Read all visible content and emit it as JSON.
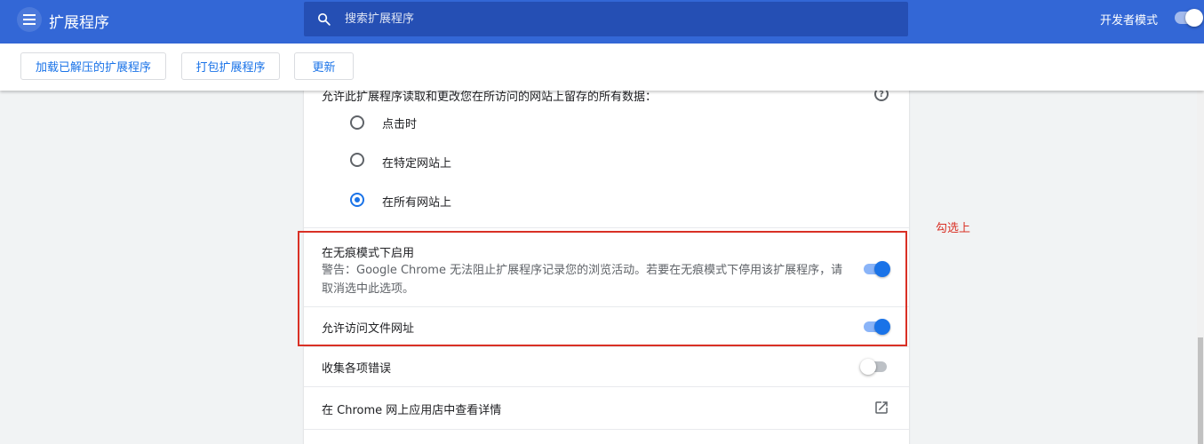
{
  "header": {
    "title": "扩展程序",
    "search_placeholder": "搜索扩展程序",
    "dev_mode_label": "开发者模式"
  },
  "toolbar": {
    "load_unpacked": "加载已解压的扩展程序",
    "pack": "打包扩展程序",
    "update": "更新"
  },
  "site_access": {
    "question": "允许此扩展程序读取和更改您在所访问的网站上留存的所有数据：",
    "options": [
      {
        "label": "点击时",
        "selected": false
      },
      {
        "label": "在特定网站上",
        "selected": false
      },
      {
        "label": "在所有网站上",
        "selected": true
      }
    ]
  },
  "settings": {
    "incognito": {
      "title": "在无痕模式下启用",
      "warning": "警告：Google Chrome 无法阻止扩展程序记录您的浏览活动。若要在无痕模式下停用该扩展程序，请取消选中此选项。",
      "enabled": true
    },
    "file_access": {
      "title": "允许访问文件网址",
      "enabled": true
    },
    "collect_errors": {
      "title": "收集各项错误",
      "enabled": false
    },
    "store_link": {
      "title": "在 Chrome 网上应用店中查看详情"
    }
  },
  "annotation": {
    "text": "勾选上"
  },
  "colors": {
    "header_bg": "#3367d6",
    "accent": "#1a73e8",
    "annotation": "#d93025"
  }
}
